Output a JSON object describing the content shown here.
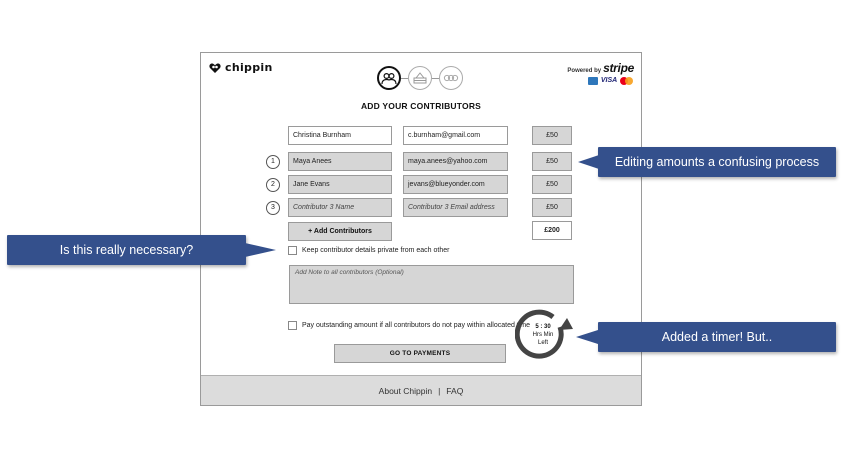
{
  "brand": {
    "name": "chippin"
  },
  "stripe": {
    "powered_by": "Powered by",
    "name": "stripe",
    "cards": [
      "AMEX",
      "VISA",
      "MC"
    ]
  },
  "steps": [
    "contributors-step",
    "payment-step",
    "confirmation-step"
  ],
  "page_title": "ADD YOUR CONTRIBUTORS",
  "organizer": {
    "name": "Christina Burnham",
    "email": "c.burnham@gmail.com",
    "amount": "£50"
  },
  "contributors": [
    {
      "number": "1",
      "name": "Maya Anees",
      "email": "maya.anees@yahoo.com",
      "amount": "£50"
    },
    {
      "number": "2",
      "name": "Jane Evans",
      "email": "jevans@blueyonder.com",
      "amount": "£50"
    },
    {
      "number": "3",
      "name_placeholder": "Contributor 3 Name",
      "email_placeholder": "Contributor 3 Email address",
      "amount": "£50"
    }
  ],
  "add_contributors_label": "+ Add Contributors",
  "total": "£200",
  "private_label": "Keep contributor details private from each other",
  "note_placeholder": "Add Note to all contributors (Optional)",
  "pay_outstanding_label": "Pay outstanding amount if all contributors do not pay within allocated time",
  "timer": {
    "time": "5 : 30",
    "units": "Hrs  Min",
    "left": "Left"
  },
  "go_to_payments_label": "GO TO PAYMENTS",
  "footer": {
    "about": "About Chippin",
    "separator": "|",
    "faq": "FAQ"
  },
  "callouts": {
    "editing": "Editing amounts a confusing process",
    "necessary": "Is this really necessary?",
    "timer": "Added a timer! But.."
  },
  "colors": {
    "callout_bg": "#34508c",
    "field_grey": "#d6d6d6",
    "footer_bg": "#dcdcdc"
  }
}
